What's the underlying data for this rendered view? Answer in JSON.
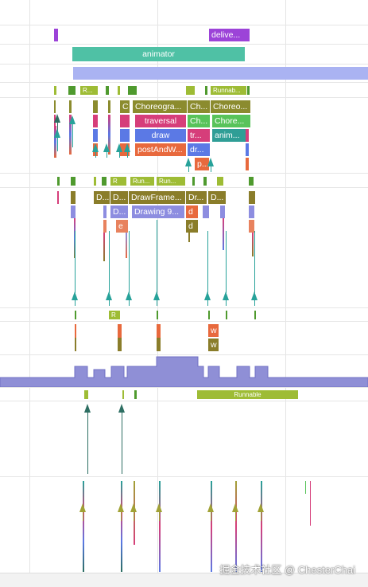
{
  "slice_labels": {
    "deliver": "delive...",
    "animator": "animator",
    "runnable": "Runnable",
    "r_short": "R...",
    "runnab": "Runnab...",
    "c": "C",
    "choreographer_long": "Choreogra...",
    "ch_a": "Ch...",
    "choreo": "Choreo...",
    "traversal": "traversal",
    "ch_b": "Ch...",
    "chore": "Chore...",
    "draw": "draw",
    "tr": "tr...",
    "anim": "anim...",
    "post_and_wait": "postAndW...",
    "dr": "dr...",
    "p": "p...",
    "r": "R",
    "run_a": "Run...",
    "run_b": "Run...",
    "d_a": "D...",
    "d_b": "D...",
    "drawframe": "DrawFrame...",
    "dr_b": "Dr...",
    "d_c": "D...",
    "d_d": "D...",
    "drawing": "Drawing 9...",
    "d_lower": "d",
    "d_lower_b": "d",
    "e": "e",
    "r2": "R",
    "w": "w",
    "w2": "w",
    "runnable_bottom": "Runnable"
  },
  "watermark": "掘金技术社区 @ ChesterChai",
  "colors": {
    "deliver": "#9c43d8",
    "animator": "#4fc1a5",
    "lavender": "#aab3f2",
    "runnable_green": "#9ebc35",
    "choreographer_olive": "#8b8b2e",
    "traversal_pink": "#d63e7a",
    "draw_blue": "#5b79e5",
    "post_orange": "#e8693d",
    "anim_teal": "#2f9e96",
    "chore_green": "#58c35a",
    "drawframe_olive": "#8a7d2a",
    "drawing_blue": "#8d8de0",
    "freq_purple": "#8f8fd6",
    "arrow_teal": "#27a29a",
    "arrow_dark": "#2d6e62",
    "arrow_olive": "#a1a235"
  }
}
